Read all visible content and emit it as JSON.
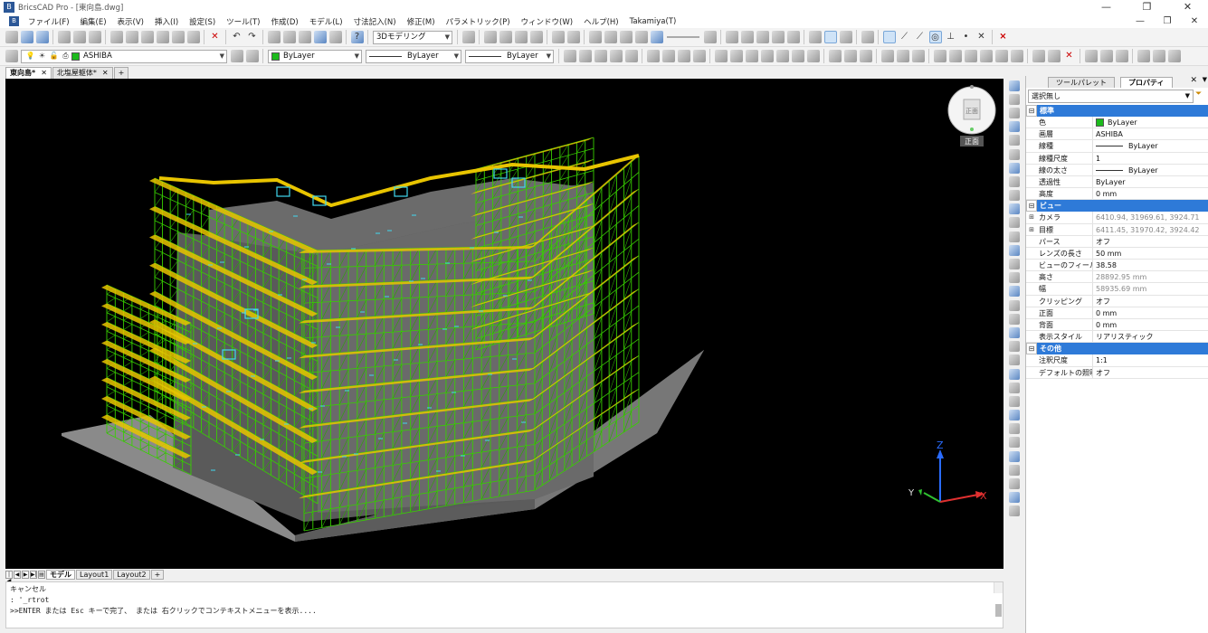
{
  "window": {
    "title": "BricsCAD Pro - [東向島.dwg]",
    "controls": [
      "—",
      "❐",
      "✕"
    ]
  },
  "menu": [
    "ファイル(F)",
    "編集(E)",
    "表示(V)",
    "挿入(I)",
    "設定(S)",
    "ツール(T)",
    "作成(D)",
    "モデル(L)",
    "寸法記入(N)",
    "修正(M)",
    "パラメトリック(P)",
    "ウィンドウ(W)",
    "ヘルプ(H)",
    "Takamiya(T)"
  ],
  "toolbar": {
    "workspace": "3Dモデリング",
    "layer": "ASHIBA",
    "color": "ByLayer",
    "linetype": "ByLayer",
    "lineweight": "ByLayer"
  },
  "doc_tabs": [
    {
      "label": "東向島*",
      "active": true
    },
    {
      "label": "北塩屋躯体*",
      "active": false
    }
  ],
  "doc_tab_add": "+",
  "layout_tabs": [
    "モデル",
    "Layout1",
    "Layout2"
  ],
  "layout_tab_add": "+",
  "viewcube": {
    "face": "正面",
    "face_label": "正面"
  },
  "ucs": {
    "x": "X",
    "y": "Y",
    "z": "Z"
  },
  "command_lines": [
    "キャンセル",
    ": '_rtrot",
    ">>ENTER または Esc キーで完了、 または 右クリックでコンテキストメニューを表示...."
  ],
  "panel": {
    "tabs": [
      "ツールパレット",
      "プロパティ"
    ],
    "selection": "選択無し",
    "sections": [
      {
        "title": "標準",
        "rows": [
          {
            "k": "色",
            "v": "ByLayer",
            "swatch": true
          },
          {
            "k": "画層",
            "v": "ASHIBA"
          },
          {
            "k": "線種",
            "v": "ByLayer",
            "line": true
          },
          {
            "k": "線種尺度",
            "v": "1"
          },
          {
            "k": "線の太さ",
            "v": "ByLayer",
            "line": true
          },
          {
            "k": "透過性",
            "v": "ByLayer"
          },
          {
            "k": "高度",
            "v": "0 mm"
          }
        ]
      },
      {
        "title": "ビュー",
        "rows": [
          {
            "k": "カメラ",
            "v": "6410.94, 31969.61, 3924.71",
            "gray": true,
            "exp": true
          },
          {
            "k": "目標",
            "v": "6411.45, 31970.42, 3924.42",
            "gray": true,
            "exp": true
          },
          {
            "k": "パース",
            "v": "オフ"
          },
          {
            "k": "レンズの長さ",
            "v": "50 mm"
          },
          {
            "k": "ビューのフィールド",
            "v": "38.58"
          },
          {
            "k": "高さ",
            "v": "28892.95 mm",
            "gray": true
          },
          {
            "k": "幅",
            "v": "58935.69 mm",
            "gray": true
          },
          {
            "k": "クリッピング",
            "v": "オフ"
          },
          {
            "k": "正面",
            "v": "0 mm"
          },
          {
            "k": "背面",
            "v": "0 mm"
          },
          {
            "k": "表示スタイル",
            "v": "リアリスティック"
          }
        ]
      },
      {
        "title": "その他",
        "rows": [
          {
            "k": "注釈尺度",
            "v": "1:1"
          },
          {
            "k": "デフォルトの照明",
            "v": "オフ"
          }
        ]
      }
    ]
  },
  "colors": {
    "scaffold": "#38d000",
    "plank": "#e8c400",
    "slab": "#6b6b6b",
    "ground": "#8a8a8a",
    "cyan": "#40d8f0",
    "accent": "#2e7ad8"
  }
}
